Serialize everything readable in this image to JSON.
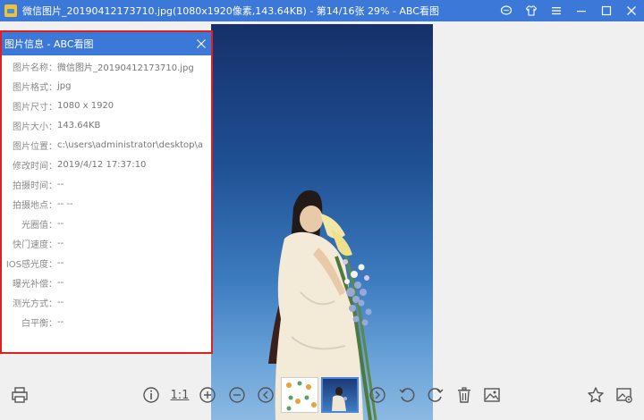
{
  "window": {
    "title": "微信图片_20190412173710.jpg(1080x1920像素,143.64KB) - 第14/16张 29% - ABC看图"
  },
  "info_panel": {
    "title": "图片信息 - ABC看图",
    "rows": [
      {
        "label": "图片名称：",
        "value": "微信图片_20190412173710.jpg"
      },
      {
        "label": "图片格式：",
        "value": "jpg"
      },
      {
        "label": "图片尺寸：",
        "value": "1080 x 1920"
      },
      {
        "label": "图片大小：",
        "value": "143.64KB"
      },
      {
        "label": "图片位置：",
        "value": "c:\\users\\administrator\\desktop\\a"
      },
      {
        "label": "修改时间：",
        "value": "2019/4/12   17:37:10"
      },
      {
        "label": "拍摄时间：",
        "value": "--"
      },
      {
        "label": "拍摄地点：",
        "value": "-- --"
      },
      {
        "label": "光圈值：",
        "value": "--"
      },
      {
        "label": "快门速度：",
        "value": "--"
      },
      {
        "label": "IOS感光度：",
        "value": "--"
      },
      {
        "label": "曝光补偿：",
        "value": "--"
      },
      {
        "label": "测光方式：",
        "value": "--"
      },
      {
        "label": "白平衡：",
        "value": "--"
      }
    ]
  },
  "toolbar": {
    "ratio_label": "1:1"
  },
  "icons": {
    "print": "print-icon",
    "info": "info-icon",
    "zoom_in": "zoom-in-icon",
    "zoom_out": "zoom-out-icon",
    "prev": "prev-icon",
    "next": "next-icon",
    "rotate_left": "rotate-left-icon",
    "rotate_right": "rotate-right-icon",
    "delete": "trash-icon",
    "edit": "image-edit-icon",
    "favorite": "star-icon",
    "wallpaper": "image-settings-icon"
  },
  "colors": {
    "titlebar": "#3b78d8",
    "panel_border": "#e02020"
  }
}
